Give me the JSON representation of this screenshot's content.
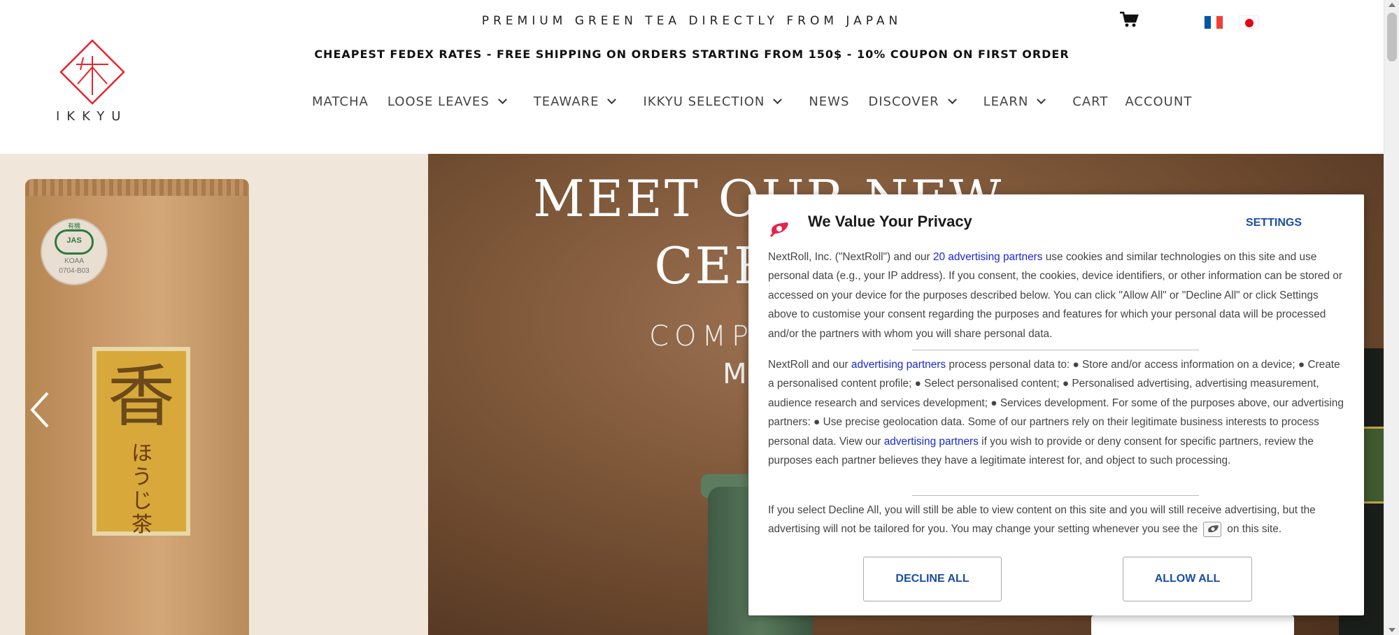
{
  "header": {
    "tagline": "PREMIUM GREEN TEA DIRECTLY FROM JAPAN",
    "shipping_banner": "CHEAPEST FEDEX RATES - FREE SHIPPING ON ORDERS STARTING FROM 150$ - 10% COUPON ON FIRST ORDER",
    "logo_text": "IKKYU",
    "cart_icon": "shopping-cart-icon",
    "flags": [
      "france-flag",
      "japan-flag"
    ]
  },
  "nav": {
    "items": [
      {
        "label": "MATCHA",
        "dropdown": false
      },
      {
        "label": "LOOSE LEAVES",
        "dropdown": true
      },
      {
        "label": "TEAWARE",
        "dropdown": true
      },
      {
        "label": "IKKYU SELECTION",
        "dropdown": true
      },
      {
        "label": "NEWS",
        "dropdown": false
      },
      {
        "label": "DISCOVER",
        "dropdown": true
      },
      {
        "label": "LEARN",
        "dropdown": true
      },
      {
        "label": "CART",
        "dropdown": false
      },
      {
        "label": "ACCOUNT",
        "dropdown": false
      }
    ]
  },
  "hero": {
    "title_line1": "MEET OUR NEW",
    "title_line2": "CEREM",
    "subtitle_line1": "COMPETITI",
    "subtitle_line2": "MA",
    "jas_text1": "有機",
    "jas_text2": "JAS",
    "jas_text3": "KOAA",
    "jas_text4": "0704-B03",
    "label_glyph": "香",
    "label_text": "ほうじ茶"
  },
  "consent": {
    "title": "We Value Your Privacy",
    "settings_label": "SETTINGS",
    "p1_a": "NextRoll, Inc. (\"NextRoll\") and our ",
    "p1_link": "20 advertising partners",
    "p1_b": " use cookies and similar technologies on this site and use personal data (e.g., your IP address). If you consent, the cookies, device identifiers, or other information can be stored or accessed on your device for the purposes described below. You can click \"Allow All\" or \"Decline All\" or click Settings above to customise your consent regarding the purposes and features for which your personal data will be processed and/or the partners with whom you will share personal data.",
    "p2_a": "NextRoll and our ",
    "p2_link1": "advertising partners",
    "p2_b": " process personal data to: ● Store and/or access information on a device; ● Create a personalised content profile; ● Select personalised content; ● Personalised advertising, advertising measurement, audience research and services development; ● Services development. For some of the purposes above, our advertising partners: ● Use precise geolocation data. Some of our partners rely on their legitimate business interests to process personal data. View our ",
    "p2_link2": "advertising partners",
    "p2_c": " if you wish to provide or deny consent for specific partners, review the purposes each partner believes they have a legitimate interest for, and object to such processing.",
    "p3_a": "If you select Decline All, you will still be able to view content on this site and you will still receive advertising, but the advertising will not be tailored for you. You may change your setting whenever you see the",
    "p3_b": "on this site.",
    "decline_label": "DECLINE ALL",
    "allow_label": "ALLOW ALL"
  },
  "colors": {
    "accent_red": "#e60012",
    "link_blue": "#1a28cc",
    "button_blue": "#1a4ea3"
  }
}
